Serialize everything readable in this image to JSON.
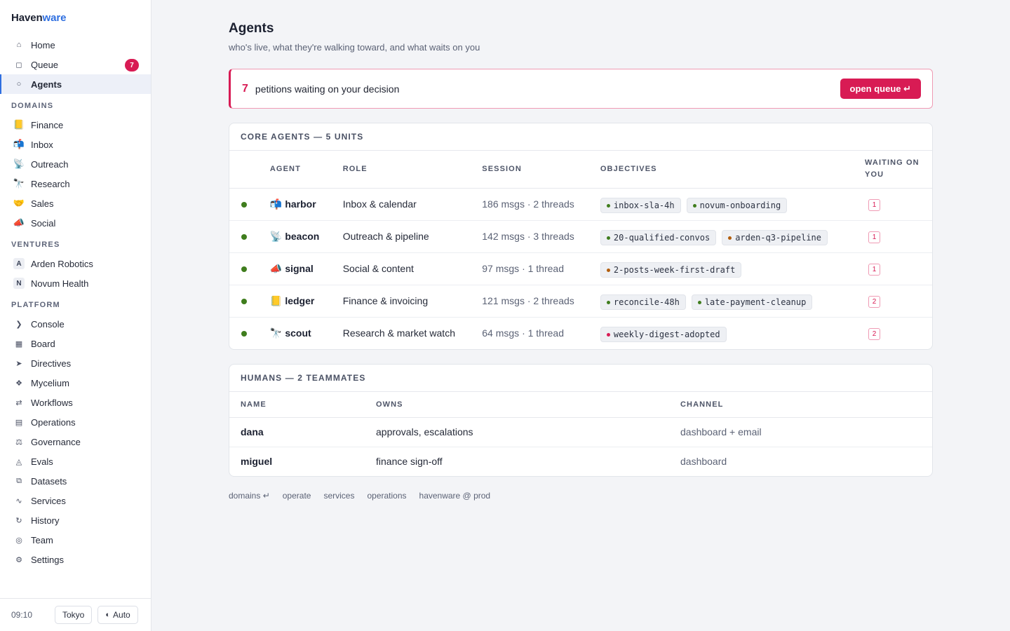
{
  "brand": {
    "part1": "Haven",
    "part2": "ware"
  },
  "sidebar": {
    "main": [
      {
        "label": "Home",
        "icon": "⌂",
        "icon_name": "home-icon"
      },
      {
        "label": "Queue",
        "icon": "◻",
        "icon_name": "queue-icon",
        "badge": "7"
      },
      {
        "label": "Agents",
        "icon": "○",
        "icon_name": "agents-icon",
        "active": true
      }
    ],
    "domains_title": "DOMAINS",
    "domains": [
      {
        "label": "Finance",
        "icon": "📒",
        "icon_name": "ledger-icon"
      },
      {
        "label": "Inbox",
        "icon": "📬",
        "icon_name": "mailbox-icon"
      },
      {
        "label": "Outreach",
        "icon": "📡",
        "icon_name": "satellite-dish-icon"
      },
      {
        "label": "Research",
        "icon": "🔭",
        "icon_name": "telescope-icon"
      },
      {
        "label": "Sales",
        "icon": "🤝",
        "icon_name": "handshake-icon"
      },
      {
        "label": "Social",
        "icon": "📣",
        "icon_name": "megaphone-icon"
      }
    ],
    "ventures_title": "VENTURES",
    "ventures": [
      {
        "label": "Arden Robotics",
        "letter": "A"
      },
      {
        "label": "Novum Health",
        "letter": "N"
      }
    ],
    "platform_title": "PLATFORM",
    "platform": [
      {
        "label": "Console",
        "icon": "❯",
        "icon_name": "console-icon"
      },
      {
        "label": "Board",
        "icon": "▦",
        "icon_name": "board-icon"
      },
      {
        "label": "Directives",
        "icon": "➤",
        "icon_name": "directives-icon"
      },
      {
        "label": "Mycelium",
        "icon": "❖",
        "icon_name": "mycelium-icon"
      },
      {
        "label": "Workflows",
        "icon": "⇄",
        "icon_name": "workflows-icon"
      },
      {
        "label": "Operations",
        "icon": "▤",
        "icon_name": "operations-icon"
      },
      {
        "label": "Governance",
        "icon": "⚖",
        "icon_name": "governance-icon"
      },
      {
        "label": "Evals",
        "icon": "◬",
        "icon_name": "evals-icon"
      },
      {
        "label": "Datasets",
        "icon": "⧉",
        "icon_name": "datasets-icon"
      },
      {
        "label": "Services",
        "icon": "∿",
        "icon_name": "services-icon"
      },
      {
        "label": "History",
        "icon": "↻",
        "icon_name": "history-icon"
      },
      {
        "label": "Team",
        "icon": "◎",
        "icon_name": "team-icon"
      },
      {
        "label": "Settings",
        "icon": "⚙",
        "icon_name": "settings-icon"
      }
    ],
    "footer": {
      "time": "09:10",
      "tz": "Tokyo",
      "theme_icon": "◐",
      "theme": "Auto"
    }
  },
  "page": {
    "title": "Agents",
    "subtitle": "who's live, what they're walking toward, and what waits on you"
  },
  "alert": {
    "count": "7",
    "text": "petitions waiting on your decision",
    "button": "open queue ↵"
  },
  "core": {
    "title": "CORE AGENTS — 5 UNITS",
    "columns": [
      "AGENT",
      "ROLE",
      "SESSION",
      "OBJECTIVES",
      "WAITING ON YOU"
    ],
    "rows": [
      {
        "status_color": "#3f7d1d",
        "emoji": "📬",
        "name": "harbor",
        "role": "Inbox & calendar",
        "session": "186 msgs · 2 threads",
        "objectives": [
          {
            "text": "inbox-sla-4h",
            "color": "#3f7d1d"
          },
          {
            "text": "novum-onboarding",
            "color": "#3f7d1d"
          }
        ],
        "waiting": "1"
      },
      {
        "status_color": "#3f7d1d",
        "emoji": "📡",
        "name": "beacon",
        "role": "Outreach & pipeline",
        "session": "142 msgs · 3 threads",
        "objectives": [
          {
            "text": "20-qualified-convos",
            "color": "#3f7d1d"
          },
          {
            "text": "arden-q3-pipeline",
            "color": "#b25e0d"
          }
        ],
        "waiting": "1"
      },
      {
        "status_color": "#3f7d1d",
        "emoji": "📣",
        "name": "signal",
        "role": "Social & content",
        "session": "97 msgs · 1 thread",
        "objectives": [
          {
            "text": "2-posts-week-first-draft",
            "color": "#b25e0d"
          }
        ],
        "waiting": "1"
      },
      {
        "status_color": "#3f7d1d",
        "emoji": "📒",
        "name": "ledger",
        "role": "Finance & invoicing",
        "session": "121 msgs · 2 threads",
        "objectives": [
          {
            "text": "reconcile-48h",
            "color": "#3f7d1d"
          },
          {
            "text": "late-payment-cleanup",
            "color": "#3f7d1d"
          }
        ],
        "waiting": "2"
      },
      {
        "status_color": "#3f7d1d",
        "emoji": "🔭",
        "name": "scout",
        "role": "Research & market watch",
        "session": "64 msgs · 1 thread",
        "objectives": [
          {
            "text": "weekly-digest-adopted",
            "color": "#d81b54"
          }
        ],
        "waiting": "2"
      }
    ]
  },
  "humans": {
    "title": "HUMANS — 2 TEAMMATES",
    "columns": [
      "NAME",
      "OWNS",
      "CHANNEL"
    ],
    "rows": [
      {
        "name": "dana",
        "owns": "approvals, escalations",
        "channel": "dashboard + email"
      },
      {
        "name": "miguel",
        "owns": "finance sign-off",
        "channel": "dashboard"
      }
    ]
  },
  "footer_links": [
    "domains ↵",
    "operate",
    "services",
    "operations",
    "havenware @ prod"
  ],
  "colors": {
    "accent": "#2f6fe0",
    "alert": "#d81b54",
    "live": "#3f7d1d"
  }
}
